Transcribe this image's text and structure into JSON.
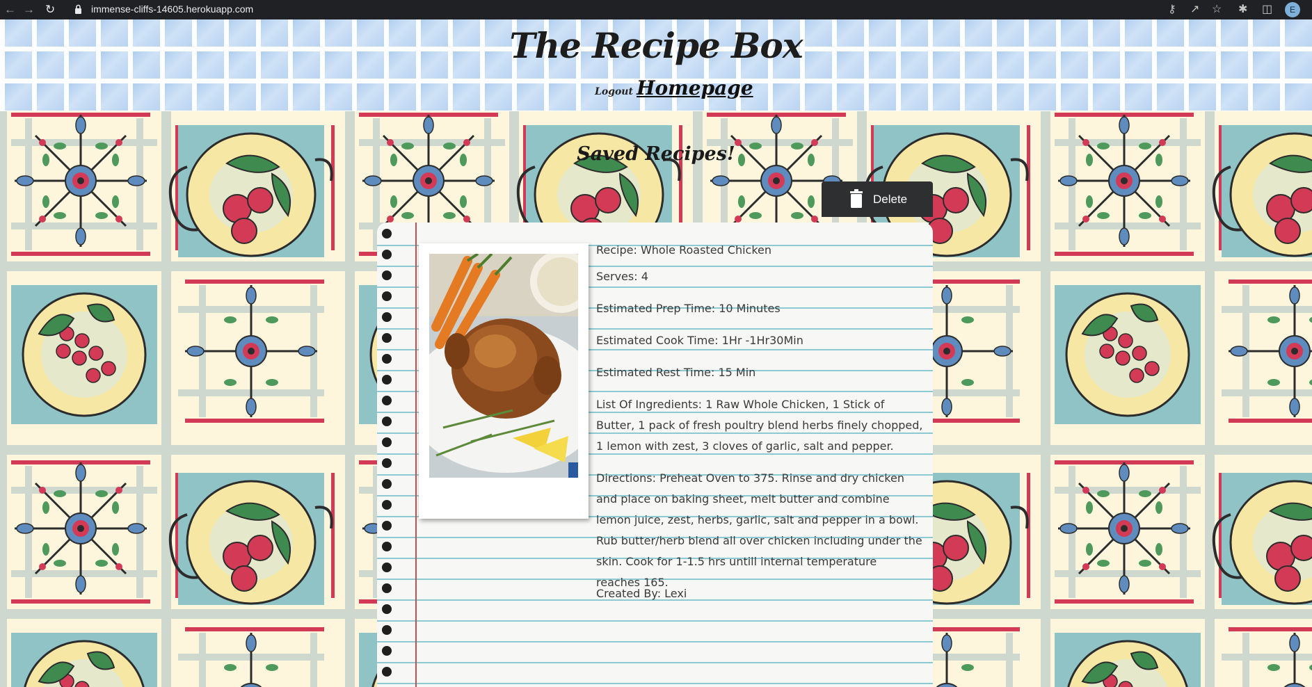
{
  "browser": {
    "url": "immense-cliffs-14605.herokuapp.com",
    "profile_initial": "E"
  },
  "header": {
    "title": "The Recipe Box",
    "logout_label": "Logout",
    "homepage_label": "Homepage"
  },
  "main": {
    "section_title": "Saved Recipes!",
    "delete_label": "Delete"
  },
  "recipe": {
    "name_line": "Recipe: Whole Roasted Chicken",
    "serves_line": "Serves: 4",
    "prep_line": "Estimated Prep Time: 10 Minutes",
    "cook_line": "Estimated Cook Time: 1Hr -1Hr30Min",
    "rest_line": "Estimated Rest Time: 15 Min",
    "ingredients_line": "List Of Ingredients: 1 Raw Whole Chicken, 1 Stick of Butter, 1 pack of fresh poultry blend herbs finely chopped, 1 lemon with zest, 3 cloves of garlic, salt and pepper.",
    "directions_line": "Directions: Preheat Oven to 375. Rinse and dry chicken and place on baking sheet, melt butter and combine lemon juice, zest, herbs, garlic, salt and pepper in a bowl. Rub butter/herb blend all over chicken including under the skin. Cook for 1-1.5 hrs untill internal temperature reaches 165.",
    "author_line": "Created By: Lexi"
  },
  "colors": {
    "chrome_bg": "#202124",
    "delete_bg": "#2e2f31",
    "ruled_line": "#8cc9d3",
    "margin_line": "#c25050",
    "tile_red": "#d23a55",
    "tile_teal": "#8fc3c6",
    "tile_yellow": "#f6e7a4"
  },
  "icons": [
    "back-arrow-icon",
    "forward-arrow-icon",
    "reload-icon",
    "lock-icon",
    "key-icon",
    "share-icon",
    "star-icon",
    "extensions-icon",
    "sidebar-icon",
    "trash-icon"
  ]
}
